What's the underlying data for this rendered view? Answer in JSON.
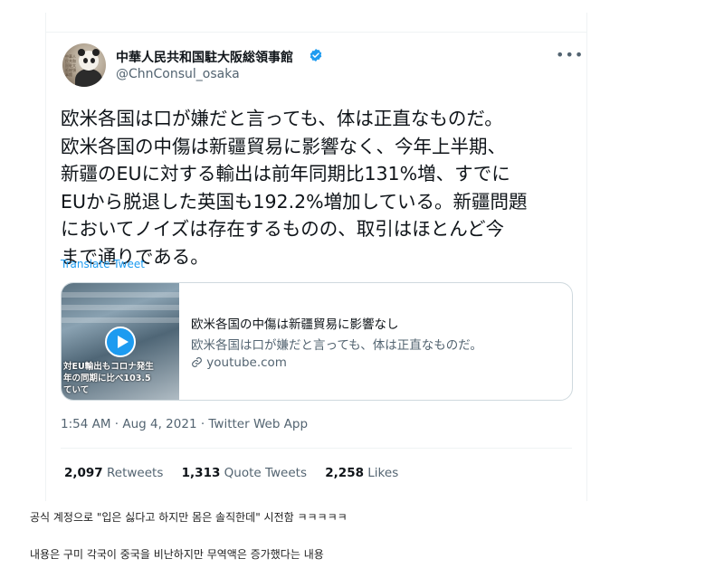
{
  "tweet": {
    "display_name": "中華人民共和国駐大阪総領事館",
    "handle": "@ChnConsul_osaka",
    "avatar_caption": "中華人民共和国駐大阪総領事館",
    "body_lines": [
      "欧米各国は口が嫌だと言っても、体は正直なものだ。",
      "欧米各国の中傷は新疆貿易に影響なく、今年上半期、",
      "新疆のEUに対する輸出は前年同期比131%増、すでに",
      "EUから脱退した英国も192.2%増加している。新疆問題",
      "においてノイズは存在するものの、取引はほとんど今",
      "まで通りである。"
    ],
    "translate_label": "Translate Tweet",
    "card": {
      "title": "欧米各国の中傷は新疆貿易に影響なし",
      "description": "欧米各国は口が嫌だと言っても、体は正直なものだ。",
      "link": "youtube.com",
      "thumbnail_caption_1": "対EU輸出もコロナ発生",
      "thumbnail_caption_2": "年の同期に比べ103.5",
      "thumbnail_caption_3": "ていて"
    },
    "timestamp": "1:54 AM · Aug 4, 2021 · Twitter Web App",
    "stats": {
      "retweets_count": "2,097",
      "retweets_label": "Retweets",
      "quotes_count": "1,313",
      "quotes_label": "Quote Tweets",
      "likes_count": "2,258",
      "likes_label": "Likes"
    },
    "more_label": "•••"
  },
  "comments": {
    "line1": "공식 계정으로 \"입은 싫다고 하지만 몸은 솔직한데\" 시전함 ㅋㅋㅋㅋㅋ",
    "line2": "내용은 구미 각국이 중국을 비난하지만 무역액은 증가했다는 내용"
  },
  "colors": {
    "accent": "#1d9bf0",
    "secondary_text": "#536471",
    "border": "#cfd9de"
  }
}
